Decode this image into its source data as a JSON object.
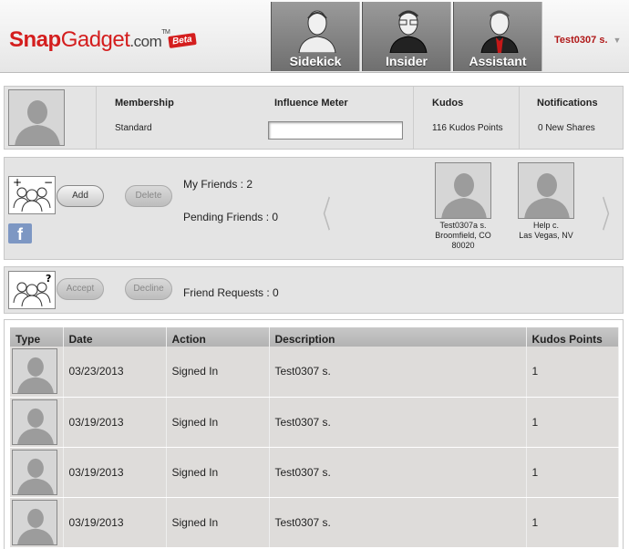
{
  "header": {
    "logo_snap": "Snap",
    "logo_gadget": "Gadget",
    "logo_com": ".com",
    "logo_tm": "TM",
    "beta": "Beta",
    "tabs": [
      {
        "label": "Sidekick",
        "icon": "sidekick-avatar-icon"
      },
      {
        "label": "Insider",
        "icon": "insider-avatar-icon"
      },
      {
        "label": "Assistant",
        "icon": "assistant-avatar-icon"
      }
    ],
    "user": "Test0307 s.",
    "colors": {
      "brand": "#d41e1e",
      "tab": "#7f7f7f"
    }
  },
  "profile": {
    "membership_label": "Membership",
    "membership_value": "Standard",
    "influence_label": "Influence Meter",
    "influence_level": 0,
    "kudos_label": "Kudos",
    "kudos_value": "116 Kudos Points",
    "notifications_label": "Notifications",
    "notifications_value": "0 New Shares"
  },
  "friends": {
    "add": "Add",
    "delete": "Delete",
    "facebook": "f",
    "my_friends": "My Friends : 2",
    "pending": "Pending Friends : 0",
    "prev": "〈",
    "next": "〉",
    "cards": [
      {
        "name": "Test0307a s.",
        "location": "Broomfield, CO",
        "zip": "80020"
      },
      {
        "name": "Help c.",
        "location": "Las Vegas, NV",
        "zip": ""
      }
    ]
  },
  "requests": {
    "accept": "Accept",
    "decline": "Decline",
    "friend_requests": "Friend Requests : 0"
  },
  "activity": {
    "columns": [
      "Type",
      "Date",
      "Action",
      "Description",
      "Kudos Points"
    ],
    "rows": [
      {
        "date": "03/23/2013",
        "action": "Signed In",
        "description": "Test0307 s.",
        "points": "1"
      },
      {
        "date": "03/19/2013",
        "action": "Signed In",
        "description": "Test0307 s.",
        "points": "1"
      },
      {
        "date": "03/19/2013",
        "action": "Signed In",
        "description": "Test0307 s.",
        "points": "1"
      },
      {
        "date": "03/19/2013",
        "action": "Signed In",
        "description": "Test0307 s.",
        "points": "1"
      }
    ]
  }
}
